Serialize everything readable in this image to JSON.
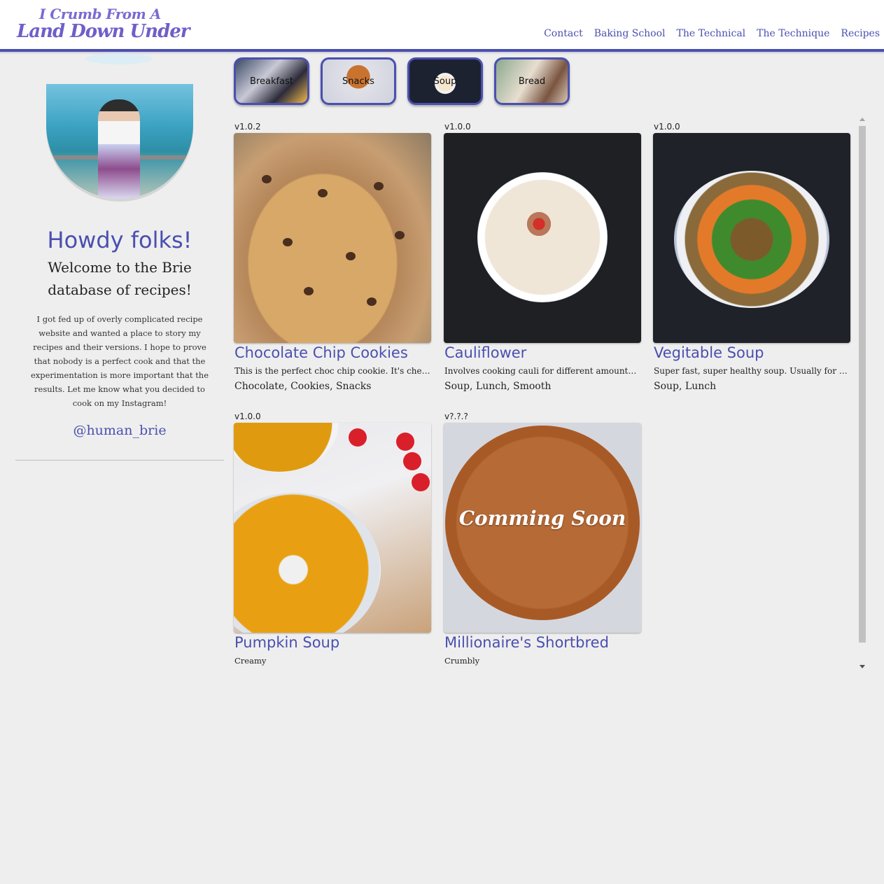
{
  "header": {
    "logo_line1": "I Crumb From A",
    "logo_line2": "Land Down Under",
    "nav": [
      "Contact",
      "Baking School",
      "The Technical",
      "The Technique",
      "Recipes"
    ]
  },
  "sidebar": {
    "greeting": "Howdy folks!",
    "welcome": "Welcome to the Brie database of recipes!",
    "intro": "I got fed up of overly complicated recipe website and wanted a place to story my recipes and their versions. I hope to prove that nobody is a perfect cook and that the experimentation is more important that the results. Let me know what you decided to cook on my Instagram!",
    "handle": "@human_brie"
  },
  "categories": [
    "Breakfast",
    "Snacks",
    "Soup",
    "Bread"
  ],
  "recipes": [
    {
      "version": "v1.0.2",
      "title": "Chocolate Chip Cookies",
      "description": "This is the perfect choc chip cookie. It's chew...",
      "tags": "Chocolate, Cookies, Snacks"
    },
    {
      "version": "v1.0.0",
      "title": "Cauliflower",
      "description": "Involves cooking cauli for different amounts ...",
      "tags": "Soup, Lunch, Smooth"
    },
    {
      "version": "v1.0.0",
      "title": "Vegitable Soup",
      "description": "Super fast, super healthy soup. Usually for lu...",
      "tags": "Soup, Lunch"
    },
    {
      "version": "v1.0.0",
      "title": "Pumpkin Soup",
      "description": "Creamy",
      "tags": ""
    },
    {
      "version": "v?.?.?",
      "title": "Millionaire's Shortbred",
      "description": "Crumbly",
      "tags": "",
      "image_overlay": "Comming Soon"
    }
  ],
  "colors": {
    "accent": "#4a4fb0",
    "background": "#eeeeee",
    "logo": "#6e5fc9"
  }
}
